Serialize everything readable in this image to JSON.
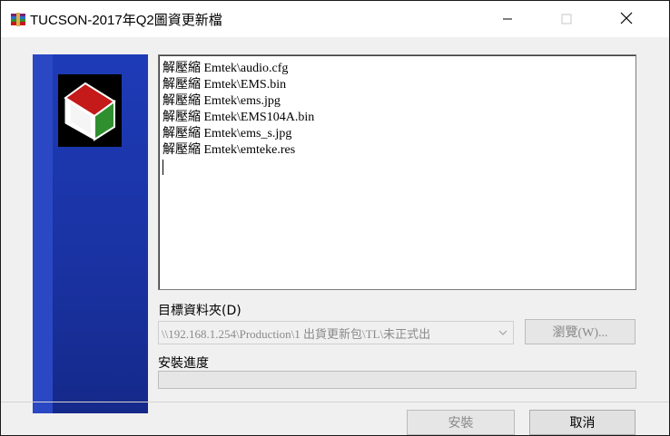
{
  "window": {
    "title": "TUCSON-2017年Q2圖資更新檔",
    "minimize_glyph": "—",
    "maximize_glyph": "☐",
    "close_glyph": "✕"
  },
  "log": {
    "lines": [
      "解壓縮 Emtek\\audio.cfg",
      "解壓縮 Emtek\\EMS.bin",
      "解壓縮 Emtek\\ems.jpg",
      "解壓縮 Emtek\\EMS104A.bin",
      "解壓縮 Emtek\\ems_s.jpg",
      "解壓縮 Emtek\\emteke.res"
    ]
  },
  "destination": {
    "label": "目標資料夾(D)",
    "value": "\\\\192.168.1.254\\Production\\1 出貨更新包\\TL\\未正式出",
    "browse_label": "瀏覽(W)..."
  },
  "progress": {
    "label": "安裝進度",
    "value": 0
  },
  "footer": {
    "install_label": "安裝",
    "cancel_label": "取消"
  },
  "colors": {
    "side_panel": "#1b35a8",
    "logo_red": "#c41a1a",
    "logo_green": "#2f8f2f",
    "logo_white": "#ffffff"
  },
  "icons": {
    "app": "winrar-books-icon",
    "side_logo": "winrar-book-logo-icon"
  }
}
